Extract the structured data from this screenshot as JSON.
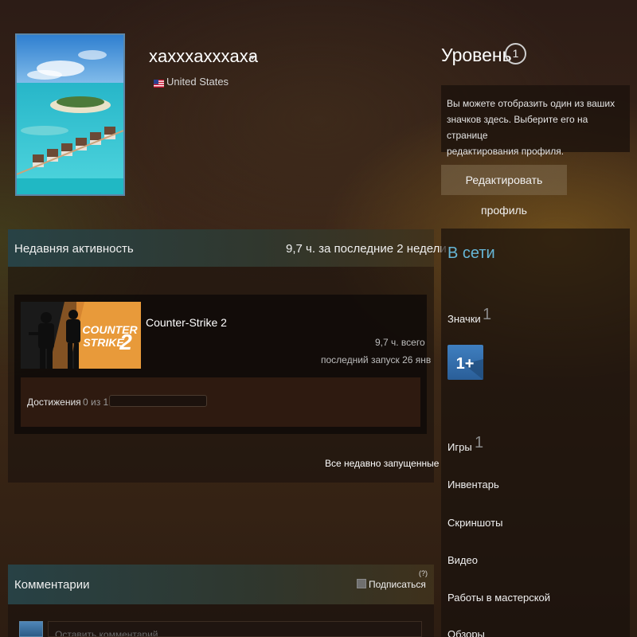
{
  "profile": {
    "username": "xaxxxaxxxaxa",
    "country": "United States"
  },
  "level": {
    "label": "Уровень",
    "value": "1"
  },
  "badge_hint": {
    "line1": "Вы можете отобразить один из ваших",
    "line2": "значков здесь. Выберите его на странице",
    "line3": "редактирования профиля."
  },
  "edit_profile_label": "Редактировать профиль",
  "recent_activity": {
    "title": "Недавняя активность",
    "hours": "9,7 ч. за последние 2 недели",
    "game": {
      "name": "Counter-Strike 2",
      "total": "9,7 ч. всего",
      "last_played": "последний запуск 26 янв",
      "capsule_text_1": "COUNTER",
      "capsule_text_2": "STRIKE",
      "capsule_num": "2"
    },
    "achievements": {
      "label": "Достижения",
      "count": "0 из 1",
      "progress": 0
    },
    "all_recent_link": "Все недавно запущенные"
  },
  "comments": {
    "title": "Комментарии",
    "subscribe_label": "Подписаться",
    "help": "(?)",
    "input_placeholder": "Оставить комментарий"
  },
  "sidebar": {
    "status": "В сети",
    "badges_label": "Значки",
    "badges_count": "1",
    "badge_icon_text": "1+",
    "games_label": "Игры",
    "games_count": "1",
    "inventory": "Инвентарь",
    "screenshots": "Скриншоты",
    "videos": "Видео",
    "workshop": "Работы в мастерской",
    "reviews": "Обзоры"
  },
  "colors": {
    "online": "#66b6d6",
    "badge_blue": "#3f7fc0",
    "capsule_orange": "#e89a3a"
  }
}
